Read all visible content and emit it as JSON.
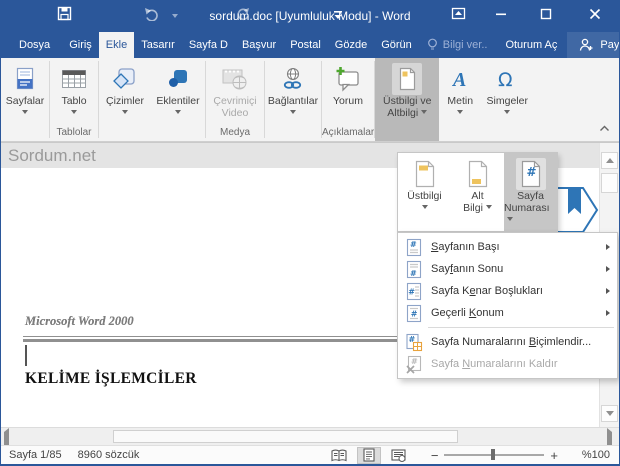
{
  "titlebar": {
    "title": "sordum.doc [Uyumluluk Modu] - Word"
  },
  "tabrow": {
    "file_tab": "Dosya",
    "tabs": [
      {
        "label": "Giriş",
        "active": false
      },
      {
        "label": "Ekle",
        "active": true
      },
      {
        "label": "Tasarır",
        "active": false
      },
      {
        "label": "Sayfa D",
        "active": false
      },
      {
        "label": "Başvur",
        "active": false
      },
      {
        "label": "Postal",
        "active": false
      },
      {
        "label": "Gözde",
        "active": false
      },
      {
        "label": "Görün",
        "active": false
      }
    ],
    "tell_me": "Bilgi ver..",
    "sign_in": "Oturum Aç",
    "share": "Paylaş"
  },
  "ribbon": {
    "sayfalar": "Sayfalar",
    "tablo": "Tablo",
    "cizimler": "Çizimler",
    "eklentiler": "Eklentiler",
    "cevrimici_line1": "Çevrimiçi",
    "cevrimici_line2": "Video",
    "baglantilar": "Bağlantılar",
    "yorum": "Yorum",
    "ustbilgi_line1": "Üstbilgi ve",
    "ustbilgi_line2": "Altbilgi",
    "metin": "Metin",
    "simgeler": "Simgeler",
    "labels": {
      "tablolar": "Tablolar",
      "medya": "Medya",
      "aciklamalar": "Açıklamalar"
    }
  },
  "flyout": {
    "ustbilgi": "Üstbilgi",
    "altbilgi_line1": "Alt",
    "altbilgi_line2": "Bilgi",
    "sayfano_line1": "Sayfa",
    "sayfano_line2": "Numarası"
  },
  "menu": {
    "items": [
      {
        "pre": "",
        "key": "S",
        "post": "ayfanın Başı",
        "submenu": true,
        "disabled": false
      },
      {
        "pre": "Say",
        "key": "f",
        "post": "anın Sonu",
        "submenu": true,
        "disabled": false
      },
      {
        "pre": "Sayfa K",
        "key": "e",
        "post": "nar Boşlukları",
        "submenu": true,
        "disabled": false
      },
      {
        "pre": "Geçerli ",
        "key": "K",
        "post": "onum",
        "submenu": true,
        "disabled": false
      },
      {
        "pre": "Sayfa Numaralarını ",
        "key": "B",
        "post": "içimlendir...",
        "submenu": false,
        "disabled": false
      },
      {
        "pre": "Sayfa ",
        "key": "N",
        "post": "umaralarını Kaldır",
        "submenu": false,
        "disabled": true
      }
    ]
  },
  "document": {
    "watermark": "Sordum.net",
    "header_text": "Microsoft Word 2000",
    "heading": "KELİME İŞLEMCİLER"
  },
  "statusbar": {
    "page": "Sayfa 1/85",
    "words": "8960 sözcük",
    "zoom_minus": "−",
    "zoom_plus": "+",
    "zoom_level": "%100"
  },
  "colors": {
    "title_blue": "#2b579a",
    "ribbon_bg": "#f3f3f3",
    "pressed_gray": "#b9b9b9",
    "flyout_pressed_gray": "#c6c6c6",
    "accent_blue": "#2e75b6",
    "icon_yellow": "#eec35e",
    "disabled_text": "#a8a8a8"
  }
}
